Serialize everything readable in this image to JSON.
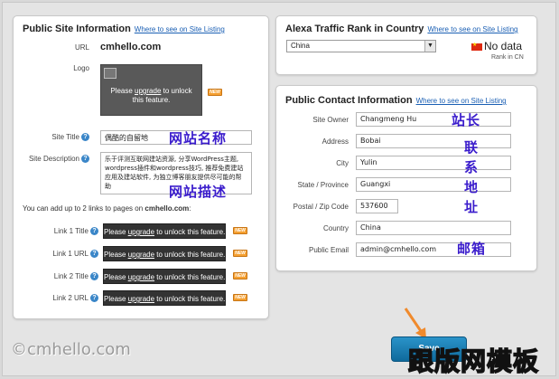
{
  "left_panel": {
    "title": "Public Site Information",
    "where_link": "Where to see on Site Listing",
    "url_label": "URL",
    "url_value": "cmhello.com",
    "logo_label": "Logo",
    "logo_lock_prefix": "Please ",
    "logo_lock_link": "upgrade",
    "logo_lock_suffix": " to unlock this feature.",
    "new_badge": "NEW",
    "site_title_label": "Site Title",
    "site_title_value": "偶酷的自留地",
    "site_desc_label": "Site Description",
    "site_desc_value": "乐于评测互联网建站资源, 分享WordPress主题, wordpress插件和wordpress技巧, 推荐免费建站应用及建站软件, 为独立博客朋友提供尽可能的帮助",
    "links_note": "You can add up to 2 links to pages on ",
    "links_note_site": "cmhello.com",
    "links_note_end": ":",
    "links": [
      {
        "label": "Link 1 Title",
        "prefix": "Please ",
        "link": "upgrade",
        "suffix": " to unlock this feature."
      },
      {
        "label": "Link 1 URL",
        "prefix": "Please ",
        "link": "upgrade",
        "suffix": " to unlock this feature."
      },
      {
        "label": "Link 2 Title",
        "prefix": "Please ",
        "link": "upgrade",
        "suffix": " to unlock this feature."
      },
      {
        "label": "Link 2 URL",
        "prefix": "Please ",
        "link": "upgrade",
        "suffix": " to unlock this feature."
      }
    ]
  },
  "alexa_panel": {
    "title": "Alexa Traffic Rank in Country",
    "where_link": "Where to see on Site Listing",
    "country_selected": "China",
    "no_data": "No data",
    "rank_in": "Rank in CN"
  },
  "contact_panel": {
    "title": "Public Contact Information",
    "where_link": "Where to see on Site Listing",
    "fields": [
      {
        "label": "Site Owner",
        "value": "Changmeng Hu"
      },
      {
        "label": "Address",
        "value": "Bobai"
      },
      {
        "label": "City",
        "value": "Yulin"
      },
      {
        "label": "State / Province",
        "value": "Guangxi"
      },
      {
        "label": "Postal / Zip Code",
        "value": "537600"
      },
      {
        "label": "Country",
        "value": "China"
      },
      {
        "label": "Public Email",
        "value": "admin@cmhello.com"
      }
    ]
  },
  "annotations": {
    "site_name": "网站名称",
    "site_desc": "网站描述",
    "owner": "站长",
    "contact_chars": [
      "联",
      "系",
      "地",
      "址"
    ],
    "email": "邮箱"
  },
  "save_button": "Save",
  "watermark_left": "©cmhello.com",
  "watermark_right": "跟版网模板",
  "colors": {
    "link": "#1a5fb4",
    "annotation": "#3a1ccc",
    "save_button": "#1479ae",
    "arrow": "#f08a2c"
  }
}
